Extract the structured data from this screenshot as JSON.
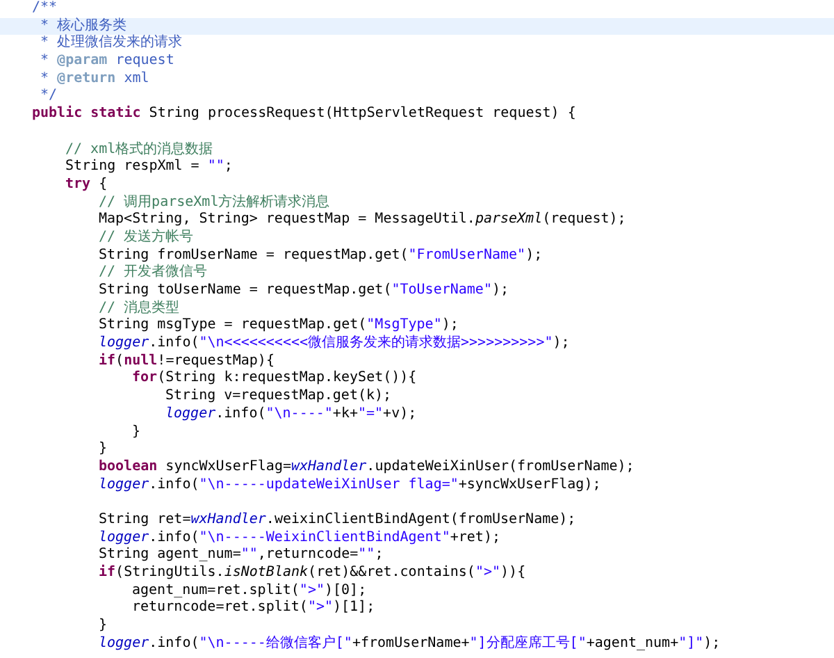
{
  "editor": {
    "lines": [
      {
        "kind": "code",
        "highlighted": false,
        "tokens": [
          {
            "kind": "doc",
            "text": "/**"
          }
        ]
      },
      {
        "kind": "doc",
        "highlighted": true,
        "tokens": [
          {
            "kind": "doc",
            "text": "* 核心服务类"
          }
        ]
      },
      {
        "kind": "doc",
        "highlighted": false,
        "tokens": [
          {
            "kind": "doc",
            "text": "* 处理微信发来的请求"
          }
        ]
      },
      {
        "kind": "doc",
        "highlighted": false,
        "tokens": [
          {
            "kind": "doc",
            "text": "* "
          },
          {
            "kind": "tag",
            "text": "@param"
          },
          {
            "kind": "doc",
            "text": " request"
          }
        ]
      },
      {
        "kind": "doc",
        "highlighted": false,
        "tokens": [
          {
            "kind": "doc",
            "text": "* "
          },
          {
            "kind": "tag",
            "text": "@return"
          },
          {
            "kind": "doc",
            "text": " xml"
          }
        ]
      },
      {
        "kind": "doc",
        "highlighted": false,
        "tokens": [
          {
            "kind": "doc",
            "text": "*/"
          }
        ]
      },
      {
        "kind": "code",
        "highlighted": false,
        "tokens": [
          {
            "kind": "kw",
            "text": "public static "
          },
          {
            "kind": "plain",
            "text": "String processRequest(HttpServletRequest request) {"
          }
        ],
        "children": [
          {
            "kind": "blank",
            "highlighted": false
          },
          {
            "kind": "code",
            "highlighted": false,
            "tokens": [
              {
                "kind": "cmt",
                "text": "// xml格式的消息数据"
              }
            ]
          },
          {
            "kind": "code",
            "highlighted": false,
            "tokens": [
              {
                "kind": "plain",
                "text": "String respXml = "
              },
              {
                "kind": "str",
                "text": "\"\""
              },
              {
                "kind": "plain",
                "text": ";"
              }
            ]
          },
          {
            "kind": "code",
            "highlighted": false,
            "tokens": [
              {
                "kind": "kw",
                "text": "try"
              },
              {
                "kind": "plain",
                "text": " {"
              }
            ],
            "children": [
              {
                "kind": "code",
                "highlighted": false,
                "tokens": [
                  {
                    "kind": "cmt",
                    "text": "// 调用parseXml方法解析请求消息"
                  }
                ]
              },
              {
                "kind": "code",
                "highlighted": false,
                "tokens": [
                  {
                    "kind": "plain",
                    "text": "Map<String, String> requestMap = MessageUtil."
                  },
                  {
                    "kind": "static",
                    "text": "parseXml"
                  },
                  {
                    "kind": "plain",
                    "text": "(request);"
                  }
                ]
              },
              {
                "kind": "code",
                "highlighted": false,
                "tokens": [
                  {
                    "kind": "cmt",
                    "text": "// 发送方帐号"
                  }
                ]
              },
              {
                "kind": "code",
                "highlighted": false,
                "tokens": [
                  {
                    "kind": "plain",
                    "text": "String fromUserName = requestMap.get("
                  },
                  {
                    "kind": "str",
                    "text": "\"FromUserName\""
                  },
                  {
                    "kind": "plain",
                    "text": ");"
                  }
                ]
              },
              {
                "kind": "code",
                "highlighted": false,
                "tokens": [
                  {
                    "kind": "cmt",
                    "text": "// 开发者微信号"
                  }
                ]
              },
              {
                "kind": "code",
                "highlighted": false,
                "tokens": [
                  {
                    "kind": "plain",
                    "text": "String toUserName = requestMap.get("
                  },
                  {
                    "kind": "str",
                    "text": "\"ToUserName\""
                  },
                  {
                    "kind": "plain",
                    "text": ");"
                  }
                ]
              },
              {
                "kind": "code",
                "highlighted": false,
                "tokens": [
                  {
                    "kind": "cmt",
                    "text": "// 消息类型"
                  }
                ]
              },
              {
                "kind": "code",
                "highlighted": false,
                "tokens": [
                  {
                    "kind": "plain",
                    "text": "String msgType = requestMap.get("
                  },
                  {
                    "kind": "str",
                    "text": "\"MsgType\""
                  },
                  {
                    "kind": "plain",
                    "text": ");"
                  }
                ]
              },
              {
                "kind": "code",
                "highlighted": false,
                "tokens": [
                  {
                    "kind": "field",
                    "text": "logger"
                  },
                  {
                    "kind": "plain",
                    "text": ".info("
                  },
                  {
                    "kind": "str",
                    "text": "\"\\n<<<<<<<<<<微信服务发来的请求数据>>>>>>>>>>\""
                  },
                  {
                    "kind": "plain",
                    "text": ");"
                  }
                ]
              },
              {
                "kind": "code",
                "highlighted": false,
                "tokens": [
                  {
                    "kind": "kw",
                    "text": "if"
                  },
                  {
                    "kind": "plain",
                    "text": "("
                  },
                  {
                    "kind": "kw",
                    "text": "null"
                  },
                  {
                    "kind": "plain",
                    "text": "!=requestMap){"
                  }
                ],
                "children": [
                  {
                    "kind": "code",
                    "highlighted": false,
                    "tokens": [
                      {
                        "kind": "kw",
                        "text": "for"
                      },
                      {
                        "kind": "plain",
                        "text": "(String k:requestMap.keySet()){"
                      }
                    ],
                    "children": [
                      {
                        "kind": "code",
                        "highlighted": false,
                        "tokens": [
                          {
                            "kind": "plain",
                            "text": "String v=requestMap.get(k);"
                          }
                        ]
                      },
                      {
                        "kind": "code",
                        "highlighted": false,
                        "tokens": [
                          {
                            "kind": "field",
                            "text": "logger"
                          },
                          {
                            "kind": "plain",
                            "text": ".info("
                          },
                          {
                            "kind": "str",
                            "text": "\"\\n----\""
                          },
                          {
                            "kind": "plain",
                            "text": "+k+"
                          },
                          {
                            "kind": "str",
                            "text": "\"=\""
                          },
                          {
                            "kind": "plain",
                            "text": "+v);"
                          }
                        ]
                      }
                    ]
                  },
                  {
                    "kind": "code",
                    "highlighted": false,
                    "tokens": [
                      {
                        "kind": "plain",
                        "text": "}"
                      }
                    ]
                  }
                ]
              },
              {
                "kind": "code",
                "highlighted": false,
                "tokens": [
                  {
                    "kind": "plain",
                    "text": "}"
                  }
                ]
              },
              {
                "kind": "code",
                "highlighted": false,
                "tokens": [
                  {
                    "kind": "kw",
                    "text": "boolean"
                  },
                  {
                    "kind": "plain",
                    "text": " syncWxUserFlag="
                  },
                  {
                    "kind": "field",
                    "text": "wxHandler"
                  },
                  {
                    "kind": "plain",
                    "text": ".updateWeiXinUser(fromUserName);"
                  }
                ]
              },
              {
                "kind": "code",
                "highlighted": false,
                "tokens": [
                  {
                    "kind": "field",
                    "text": "logger"
                  },
                  {
                    "kind": "plain",
                    "text": ".info("
                  },
                  {
                    "kind": "str",
                    "text": "\"\\n-----updateWeiXinUser flag=\""
                  },
                  {
                    "kind": "plain",
                    "text": "+syncWxUserFlag);"
                  }
                ]
              },
              {
                "kind": "blank",
                "highlighted": false
              },
              {
                "kind": "code",
                "highlighted": false,
                "tokens": [
                  {
                    "kind": "plain",
                    "text": "String ret="
                  },
                  {
                    "kind": "field",
                    "text": "wxHandler"
                  },
                  {
                    "kind": "plain",
                    "text": ".weixinClientBindAgent(fromUserName);"
                  }
                ]
              },
              {
                "kind": "code",
                "highlighted": false,
                "tokens": [
                  {
                    "kind": "field",
                    "text": "logger"
                  },
                  {
                    "kind": "plain",
                    "text": ".info("
                  },
                  {
                    "kind": "str",
                    "text": "\"\\n-----WeixinClientBindAgent\""
                  },
                  {
                    "kind": "plain",
                    "text": "+ret);"
                  }
                ]
              },
              {
                "kind": "code",
                "highlighted": false,
                "tokens": [
                  {
                    "kind": "plain",
                    "text": "String agent_num="
                  },
                  {
                    "kind": "str",
                    "text": "\"\""
                  },
                  {
                    "kind": "plain",
                    "text": ",returncode="
                  },
                  {
                    "kind": "str",
                    "text": "\"\""
                  },
                  {
                    "kind": "plain",
                    "text": ";"
                  }
                ]
              },
              {
                "kind": "code",
                "highlighted": false,
                "tokens": [
                  {
                    "kind": "kw",
                    "text": "if"
                  },
                  {
                    "kind": "plain",
                    "text": "(StringUtils."
                  },
                  {
                    "kind": "static",
                    "text": "isNotBlank"
                  },
                  {
                    "kind": "plain",
                    "text": "(ret)&&ret.contains("
                  },
                  {
                    "kind": "str",
                    "text": "\">\""
                  },
                  {
                    "kind": "plain",
                    "text": ")){"
                  }
                ],
                "children": [
                  {
                    "kind": "code",
                    "highlighted": false,
                    "tokens": [
                      {
                        "kind": "plain",
                        "text": "agent_num=ret.split("
                      },
                      {
                        "kind": "str",
                        "text": "\">\""
                      },
                      {
                        "kind": "plain",
                        "text": ")[0];"
                      }
                    ]
                  },
                  {
                    "kind": "code",
                    "highlighted": false,
                    "tokens": [
                      {
                        "kind": "plain",
                        "text": "returncode=ret.split("
                      },
                      {
                        "kind": "str",
                        "text": "\">\""
                      },
                      {
                        "kind": "plain",
                        "text": ")[1];"
                      }
                    ]
                  }
                ]
              },
              {
                "kind": "code",
                "highlighted": false,
                "tokens": [
                  {
                    "kind": "plain",
                    "text": "}"
                  }
                ]
              },
              {
                "kind": "code",
                "highlighted": false,
                "tokens": [
                  {
                    "kind": "field",
                    "text": "logger"
                  },
                  {
                    "kind": "plain",
                    "text": ".info("
                  },
                  {
                    "kind": "str",
                    "text": "\"\\n-----给微信客户[\""
                  },
                  {
                    "kind": "plain",
                    "text": "+fromUserName+"
                  },
                  {
                    "kind": "str",
                    "text": "\"]分配座席工号[\""
                  },
                  {
                    "kind": "plain",
                    "text": "+agent_num+"
                  },
                  {
                    "kind": "str",
                    "text": "\"]\""
                  },
                  {
                    "kind": "plain",
                    "text": ");"
                  }
                ]
              }
            ]
          }
        ]
      }
    ]
  }
}
